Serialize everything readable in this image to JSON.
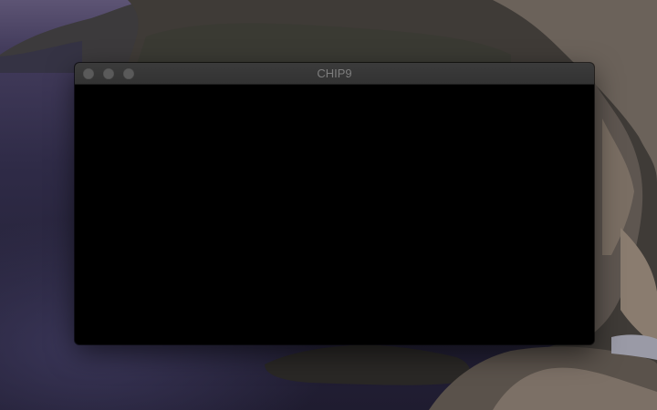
{
  "window": {
    "title": "CHIP9"
  },
  "colors": {
    "window_background": "#000000",
    "titlebar_background": "#363636",
    "title_text": "#7d7d7d",
    "traffic_light_inactive": "#5a5a5a"
  },
  "icons": {
    "close": "close-icon",
    "minimize": "minimize-icon",
    "zoom": "zoom-icon"
  }
}
